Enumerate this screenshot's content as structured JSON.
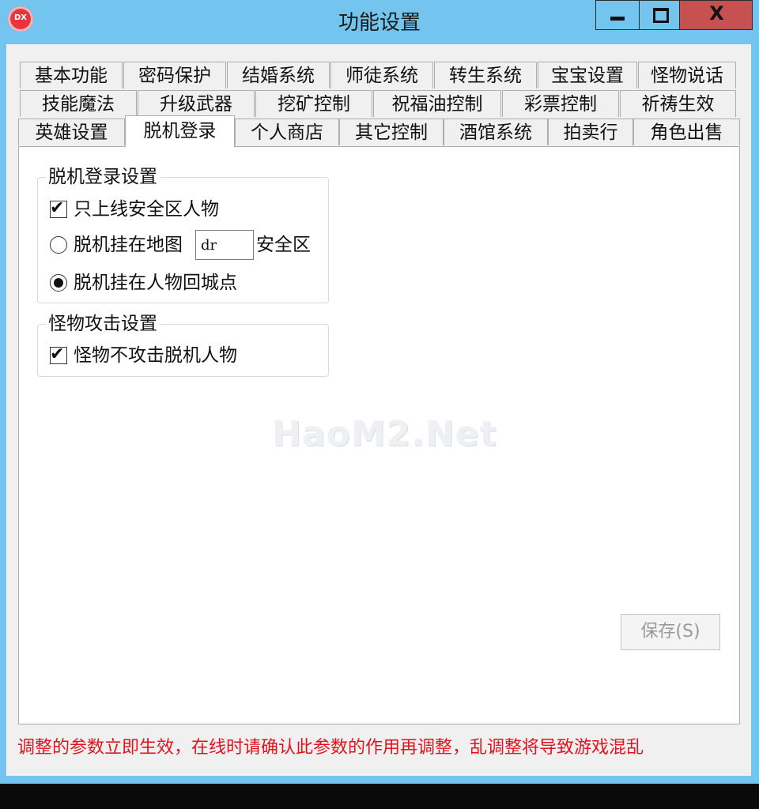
{
  "window": {
    "title": "功能设置",
    "icon_text": "DX",
    "controls": {
      "minimize": "minimize-icon",
      "maximize": "maximize-icon",
      "close_label": "X"
    }
  },
  "tabs": {
    "row1": [
      "基本功能",
      "密码保护",
      "结婚系统",
      "师徒系统",
      "转生系统",
      "宝宝设置",
      "怪物说话"
    ],
    "row2": [
      "技能魔法",
      "升级武器",
      "挖矿控制",
      "祝福油控制",
      "彩票控制",
      "祈祷生效"
    ],
    "row3": [
      "英雄设置",
      "脱机登录",
      "个人商店",
      "其它控制",
      "酒馆系统",
      "拍卖行",
      "角色出售"
    ],
    "active": "脱机登录"
  },
  "offline_login": {
    "title": "脱机登录设置",
    "only_safe_zone": {
      "label": "只上线安全区人物",
      "checked": true
    },
    "hang_on_map": {
      "label": "脱机挂在地图",
      "value": "dr",
      "suffix": "安全区",
      "selected": false
    },
    "hang_on_return_point": {
      "label": "脱机挂在人物回城点",
      "selected": true
    }
  },
  "monster_attack": {
    "title": "怪物攻击设置",
    "no_attack_offline": {
      "label": "怪物不攻击脱机人物",
      "checked": true
    }
  },
  "watermark": "HaoM2.Net",
  "save_button": {
    "label": "保存(S)",
    "enabled": false
  },
  "notice": "调整的参数立即生效，在线时请确认此参数的作用再调整，乱调整将导致游戏混乱",
  "colors": {
    "title_bar": "#73c5ef",
    "notice": "#e0141e",
    "close_button": "#c75050"
  }
}
